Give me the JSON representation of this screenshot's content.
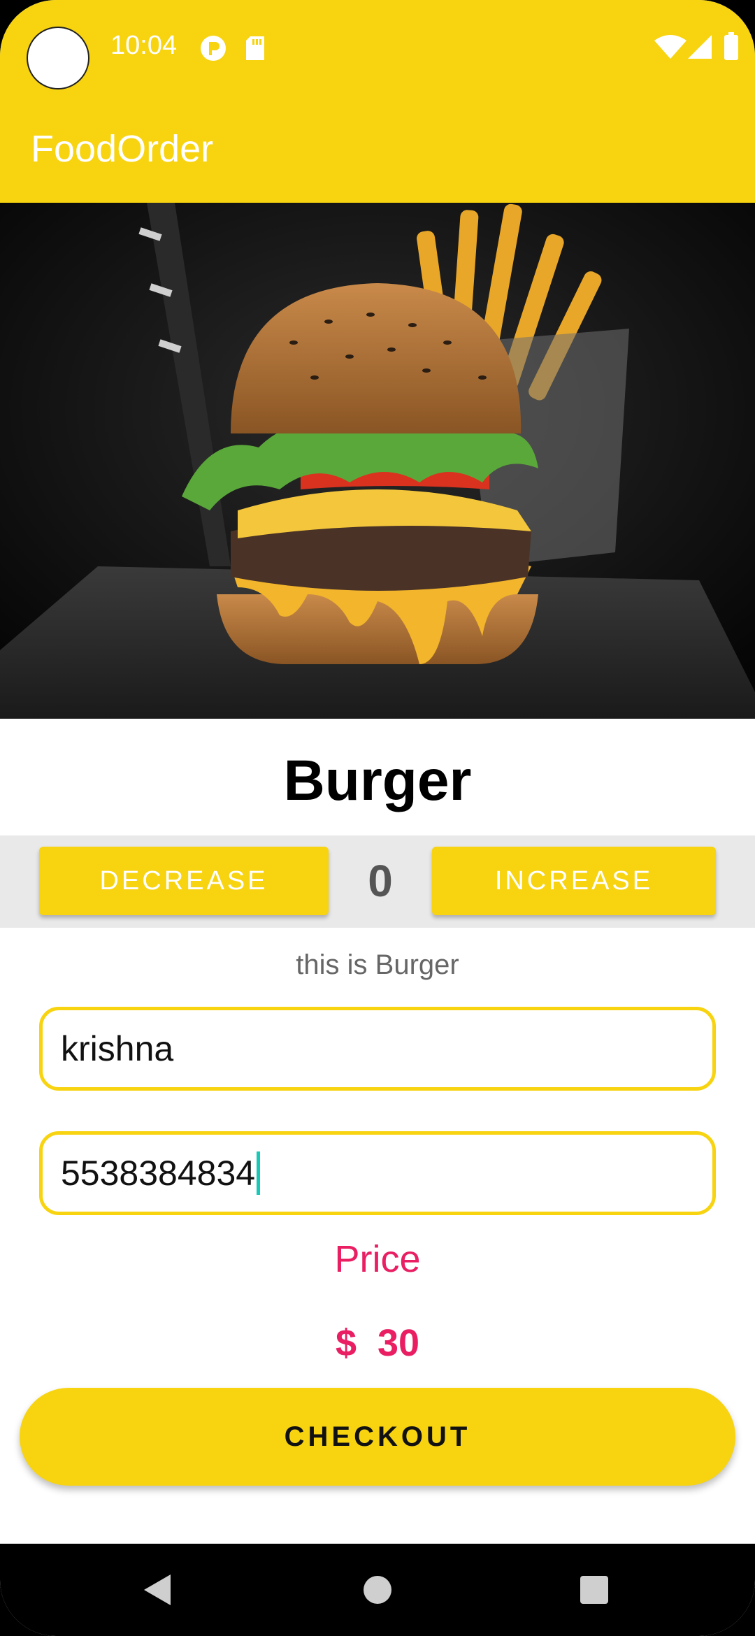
{
  "status": {
    "time": "10:04"
  },
  "app": {
    "title": "FoodOrder"
  },
  "item": {
    "name": "Burger",
    "description": "this is Burger"
  },
  "quantity": {
    "decrease_label": "DECREASE",
    "value": "0",
    "increase_label": "INCREASE"
  },
  "form": {
    "name_value": "krishna",
    "phone_value": "5538384834"
  },
  "price": {
    "label": "Price",
    "value": "$  30"
  },
  "checkout_label": "CHECKOUT",
  "icons": {
    "status_left": [
      "sync-icon",
      "sd-card-icon"
    ],
    "status_right": [
      "wifi-icon",
      "cell-signal-icon",
      "battery-icon"
    ],
    "nav": [
      "back-icon",
      "home-icon",
      "recents-icon"
    ]
  },
  "colors": {
    "accent": "#f7d310",
    "price": "#e91e63",
    "caret": "#18c9b8"
  }
}
